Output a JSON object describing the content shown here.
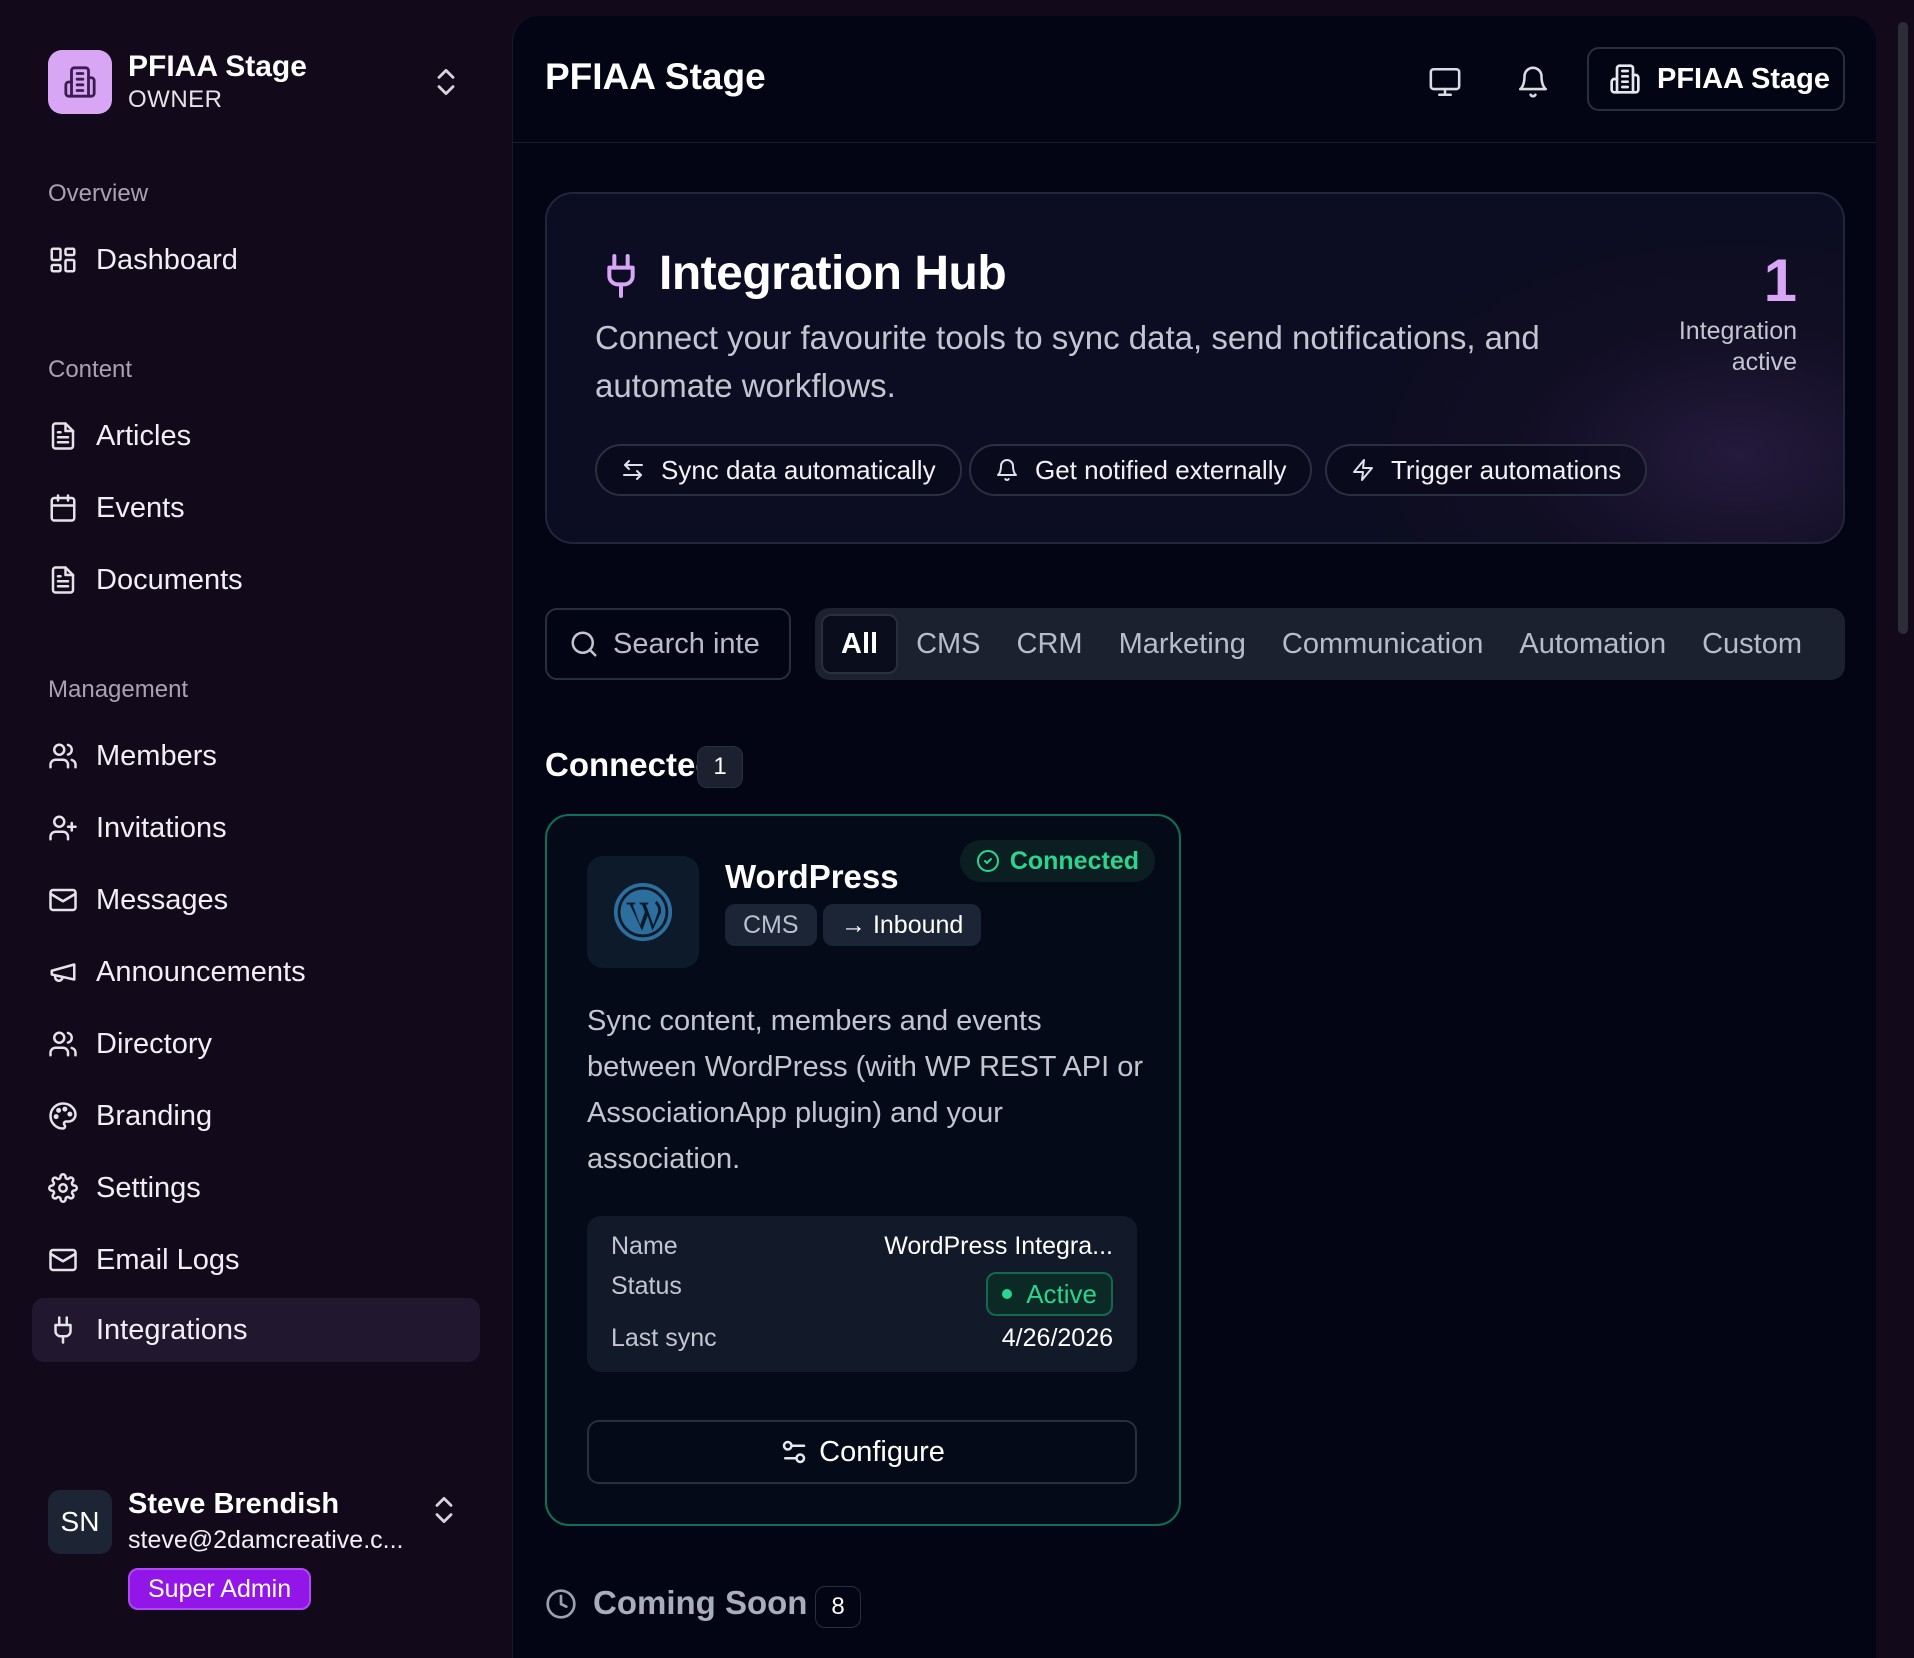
{
  "org": {
    "name": "PFIAA Stage",
    "role": "OWNER",
    "logo_icon": "building-icon"
  },
  "sidebar": {
    "sections": [
      {
        "title": "Overview",
        "items": [
          {
            "label": "Dashboard",
            "icon": "dashboard-icon"
          }
        ]
      },
      {
        "title": "Content",
        "items": [
          {
            "label": "Articles",
            "icon": "document-icon"
          },
          {
            "label": "Events",
            "icon": "calendar-icon"
          },
          {
            "label": "Documents",
            "icon": "document-icon"
          }
        ]
      },
      {
        "title": "Management",
        "items": [
          {
            "label": "Members",
            "icon": "users-icon"
          },
          {
            "label": "Invitations",
            "icon": "user-plus-icon"
          },
          {
            "label": "Messages",
            "icon": "mail-icon"
          },
          {
            "label": "Announcements",
            "icon": "megaphone-icon"
          },
          {
            "label": "Directory",
            "icon": "users-icon"
          },
          {
            "label": "Branding",
            "icon": "palette-icon"
          },
          {
            "label": "Settings",
            "icon": "gear-icon"
          },
          {
            "label": "Email Logs",
            "icon": "mail-icon"
          },
          {
            "label": "Integrations",
            "icon": "plug-icon",
            "active": true
          }
        ]
      }
    ]
  },
  "user": {
    "initials": "SN",
    "name": "Steve Brendish",
    "email": "steve@2damcreative.c...",
    "role": "Super Admin"
  },
  "topbar": {
    "title": "PFIAA Stage",
    "org_button_label": "PFIAA Stage",
    "icons": [
      "monitor-icon",
      "bell-icon"
    ]
  },
  "hero": {
    "title": "Integration Hub",
    "description": "Connect your favourite tools to sync data, send notifications, and automate workflows.",
    "stat_value": "1",
    "stat_label": "Integration active",
    "pills": [
      {
        "label": "Sync data automatically",
        "icon": "sync-icon"
      },
      {
        "label": "Get notified externally",
        "icon": "bell-icon"
      },
      {
        "label": "Trigger automations",
        "icon": "zap-icon"
      }
    ]
  },
  "search": {
    "placeholder": "Search inte"
  },
  "filters": {
    "tabs": [
      "All",
      "CMS",
      "CRM",
      "Marketing",
      "Communication",
      "Automation",
      "Custom"
    ],
    "active": "All"
  },
  "connected": {
    "title": "Connected",
    "count": "1",
    "card": {
      "name": "WordPress",
      "logo_icon": "wordpress-icon",
      "tags": [
        "CMS",
        "→ Inbound"
      ],
      "status_badge": "Connected",
      "description": "Sync content, members and events between WordPress (with WP REST API or AssociationApp plugin) and your association.",
      "details": {
        "name_label": "Name",
        "name_value": "WordPress Integra...",
        "status_label": "Status",
        "status_value": "Active",
        "last_sync_label": "Last sync",
        "last_sync_value": "4/26/2026"
      },
      "configure_label": "Configure"
    }
  },
  "coming_soon": {
    "title": "Coming Soon",
    "count": "8"
  },
  "colors": {
    "accent_purple": "#d8a6f5",
    "success_green": "#2bd58e",
    "super_admin": "#9216e8",
    "background": "#030514"
  }
}
